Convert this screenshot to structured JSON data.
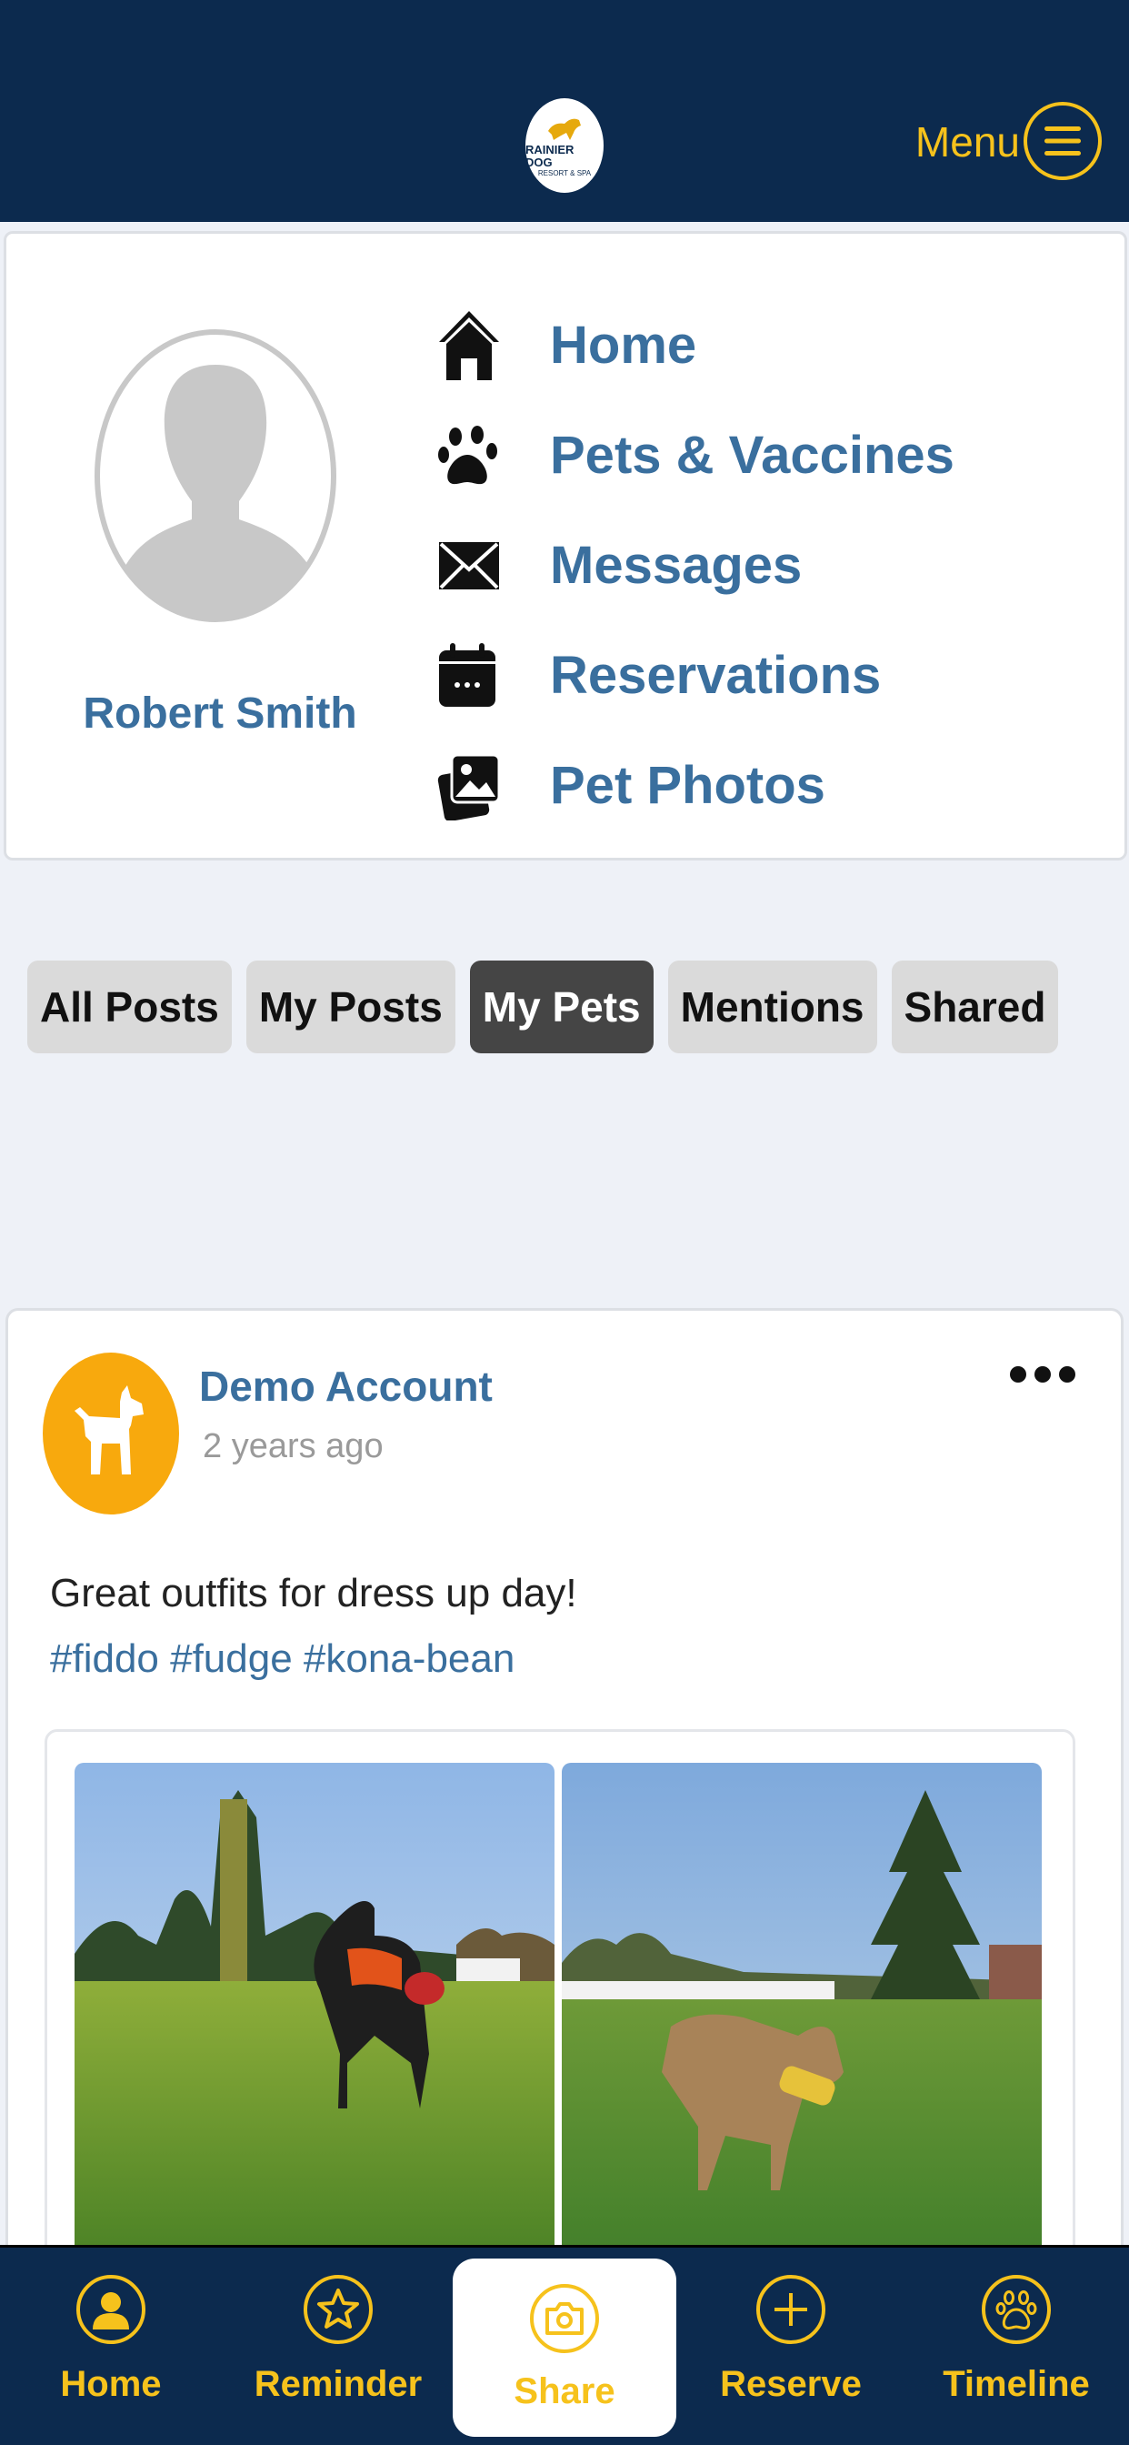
{
  "header": {
    "logo": {
      "line1": "RAINIER DOG",
      "line2": "RESORT & SPA"
    },
    "menu_label": "Menu"
  },
  "profile": {
    "name": "Robert Smith",
    "nav": [
      {
        "label": "Home",
        "icon": "house-icon"
      },
      {
        "label": "Pets & Vaccines",
        "icon": "paw-icon"
      },
      {
        "label": "Messages",
        "icon": "envelope-icon"
      },
      {
        "label": "Reservations",
        "icon": "calendar-icon"
      },
      {
        "label": "Pet Photos",
        "icon": "photos-icon"
      }
    ]
  },
  "tabs": [
    {
      "label": "All Posts",
      "active": false
    },
    {
      "label": "My Posts",
      "active": false
    },
    {
      "label": "My Pets",
      "active": true
    },
    {
      "label": "Mentions",
      "active": false
    },
    {
      "label": "Shared",
      "active": false
    }
  ],
  "post": {
    "author": "Demo Account",
    "time": "2 years ago",
    "text": "Great outfits for dress up day!",
    "tags": "#fiddo #fudge #kona-bean"
  },
  "bottom_nav": [
    {
      "label": "Home",
      "icon": "person-icon"
    },
    {
      "label": "Reminder",
      "icon": "star-icon"
    },
    {
      "label": "Share",
      "icon": "camera-icon"
    },
    {
      "label": "Reserve",
      "icon": "plus-icon"
    },
    {
      "label": "Timeline",
      "icon": "paw-icon"
    }
  ],
  "colors": {
    "navy": "#0c2a4e",
    "accent": "#f6c21c",
    "link_blue": "#3a6f9e",
    "avatar_orange": "#f8a90d"
  }
}
